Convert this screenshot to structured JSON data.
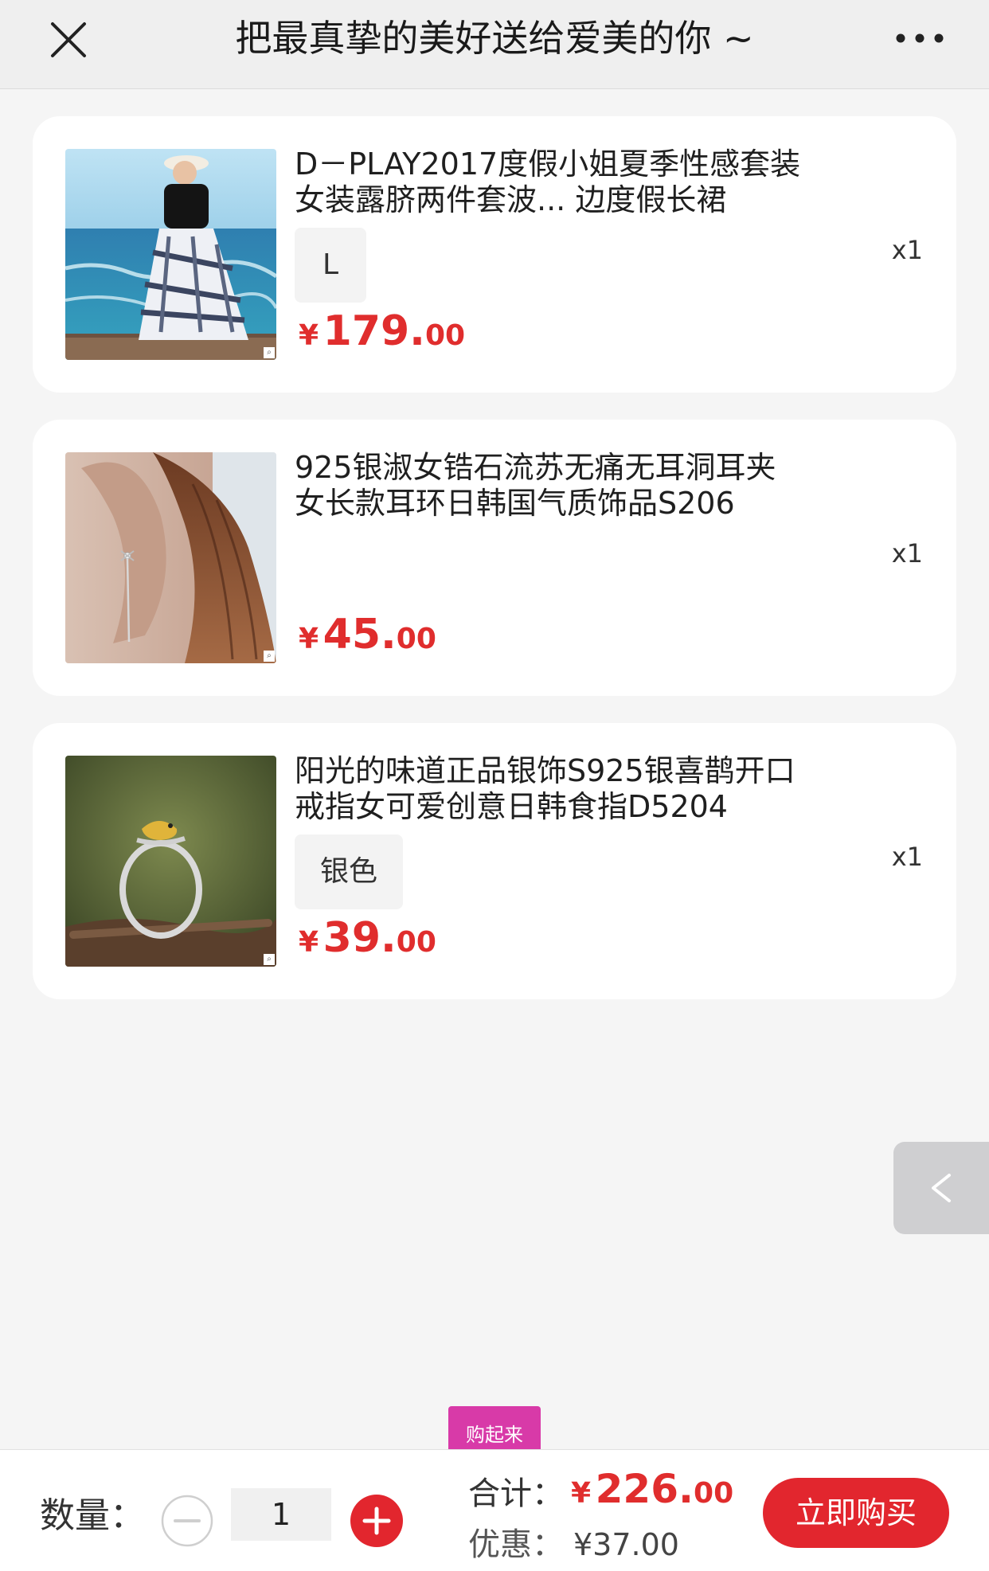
{
  "header": {
    "title": "把最真挚的美好送给爱美的你 ~"
  },
  "items": [
    {
      "title": "D－PLAY2017度假小姐夏季性感套装女装露脐两件套波... 边度假长裙",
      "sku": "L",
      "price_symbol": "¥",
      "price_int": "179.",
      "price_dec": "00",
      "qty": "x1"
    },
    {
      "title": "925银淑女锆石流苏无痛无耳洞耳夹女长款耳环日韩国气质饰品S206",
      "sku": "",
      "price_symbol": "¥",
      "price_int": "45.",
      "price_dec": "00",
      "qty": "x1"
    },
    {
      "title": "阳光的味道正品银饰S925银喜鹊开口戒指女可爱创意日韩食指D5204",
      "sku": "银色",
      "price_symbol": "¥",
      "price_int": "39.",
      "price_dec": "00",
      "qty": "x1"
    }
  ],
  "promo_tag": "购起来",
  "footer": {
    "qty_label": "数量：",
    "qty_value": "1",
    "total_label": "合计：",
    "total_symbol": "¥",
    "total_int": "226.",
    "total_dec": "00",
    "discount_label": "优惠：",
    "discount_value": "¥37.00",
    "buy_label": "立即购买"
  },
  "colors": {
    "accent_red": "#e2262e",
    "price_red": "#e02d2d",
    "promo_pink": "#d83aa8"
  }
}
